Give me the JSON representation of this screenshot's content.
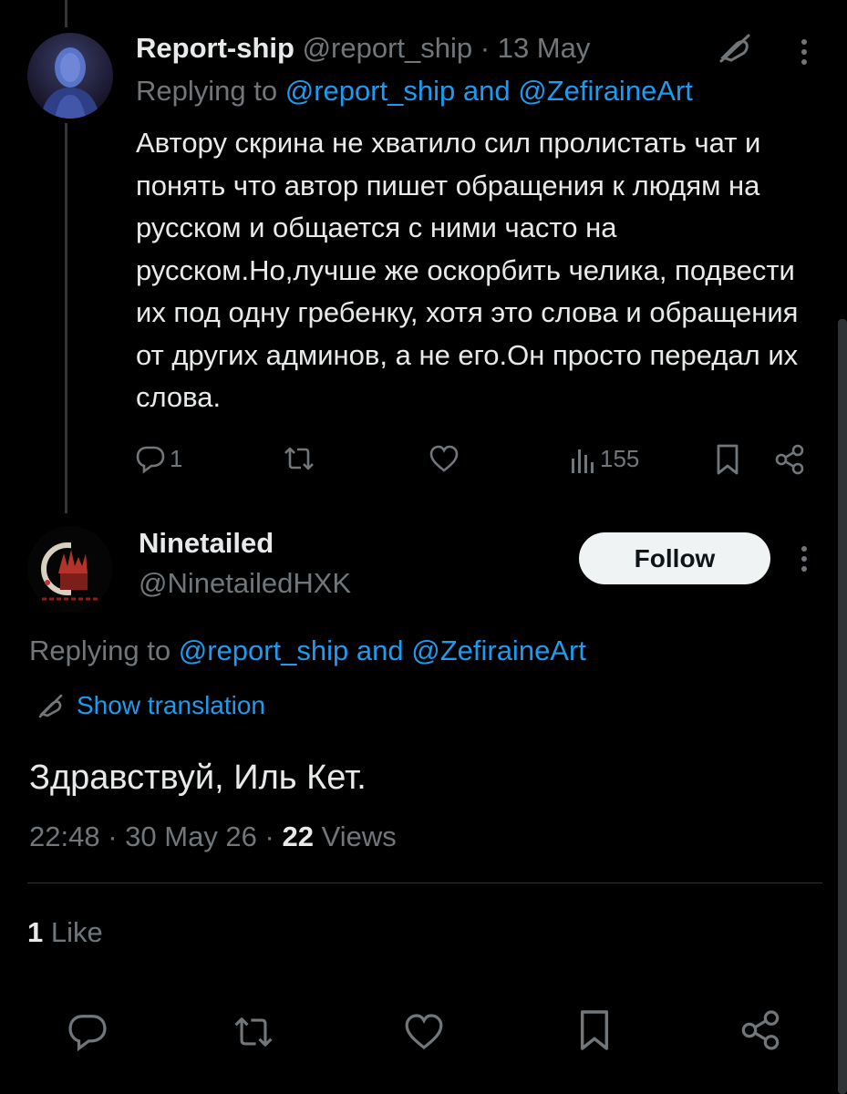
{
  "reply_tweet": {
    "display_name": "Report-ship",
    "handle": "@report_ship",
    "separator": "·",
    "date": "13 May",
    "replying_prefix": "Replying to",
    "replying_users": "@report_ship and @ZefiraineArt",
    "text": "Автору скрина не хватило сил пролистать чат и понять что автор пишет обращения к людям на русском и общается с ними часто на русском.Но,лучше же оскорбить челика, подвести их под одну гребенку, хотя это слова и обращения от других админов, а не его.Он просто передал их слова.",
    "actions": {
      "reply_count": "1",
      "repost_count": "",
      "like_count": "",
      "views_count": "155"
    }
  },
  "main_tweet": {
    "display_name": "Ninetailed",
    "handle": "@NinetailedHXK",
    "follow_label": "Follow",
    "replying_prefix": "Replying to",
    "replying_users": "@report_ship and @ZefiraineArt",
    "translation_label": "Show translation",
    "text": "Здравствуй, Иль Кет.",
    "time": "22:48",
    "date": "30 May 26",
    "separator": "·",
    "views_count": "22",
    "views_label": "Views",
    "likes_count": "1",
    "likes_label": "Like"
  },
  "colors": {
    "background": "#000000",
    "text": "#e7e9ea",
    "muted": "#71767b",
    "link": "#1d9bf0",
    "follow_button_bg": "#eff3f4"
  },
  "icons": [
    "no-edit-icon",
    "more-icon",
    "reply-icon",
    "repost-icon",
    "like-icon",
    "views-icon",
    "bookmark-icon",
    "share-icon",
    "translate-icon"
  ]
}
